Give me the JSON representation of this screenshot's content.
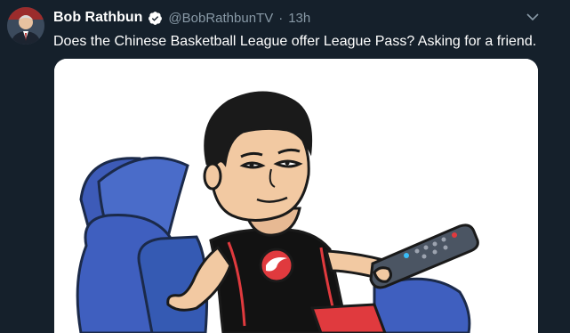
{
  "tweet": {
    "author_name": "Bob Rathbun",
    "handle": "@BobRathbunTV",
    "separator": "·",
    "time": "13h",
    "text": "Does the Chinese Basketball League offer League Pass? Asking for a friend."
  },
  "colors": {
    "background": "#15202b",
    "secondary_text": "#8899a6",
    "verified": "#1da1f2",
    "jersey_accent": "#e03a3e"
  },
  "icons": {
    "verified": "verified-badge-icon",
    "menu": "chevron-down-icon"
  },
  "media": {
    "description_type": "bitmoji-image"
  }
}
